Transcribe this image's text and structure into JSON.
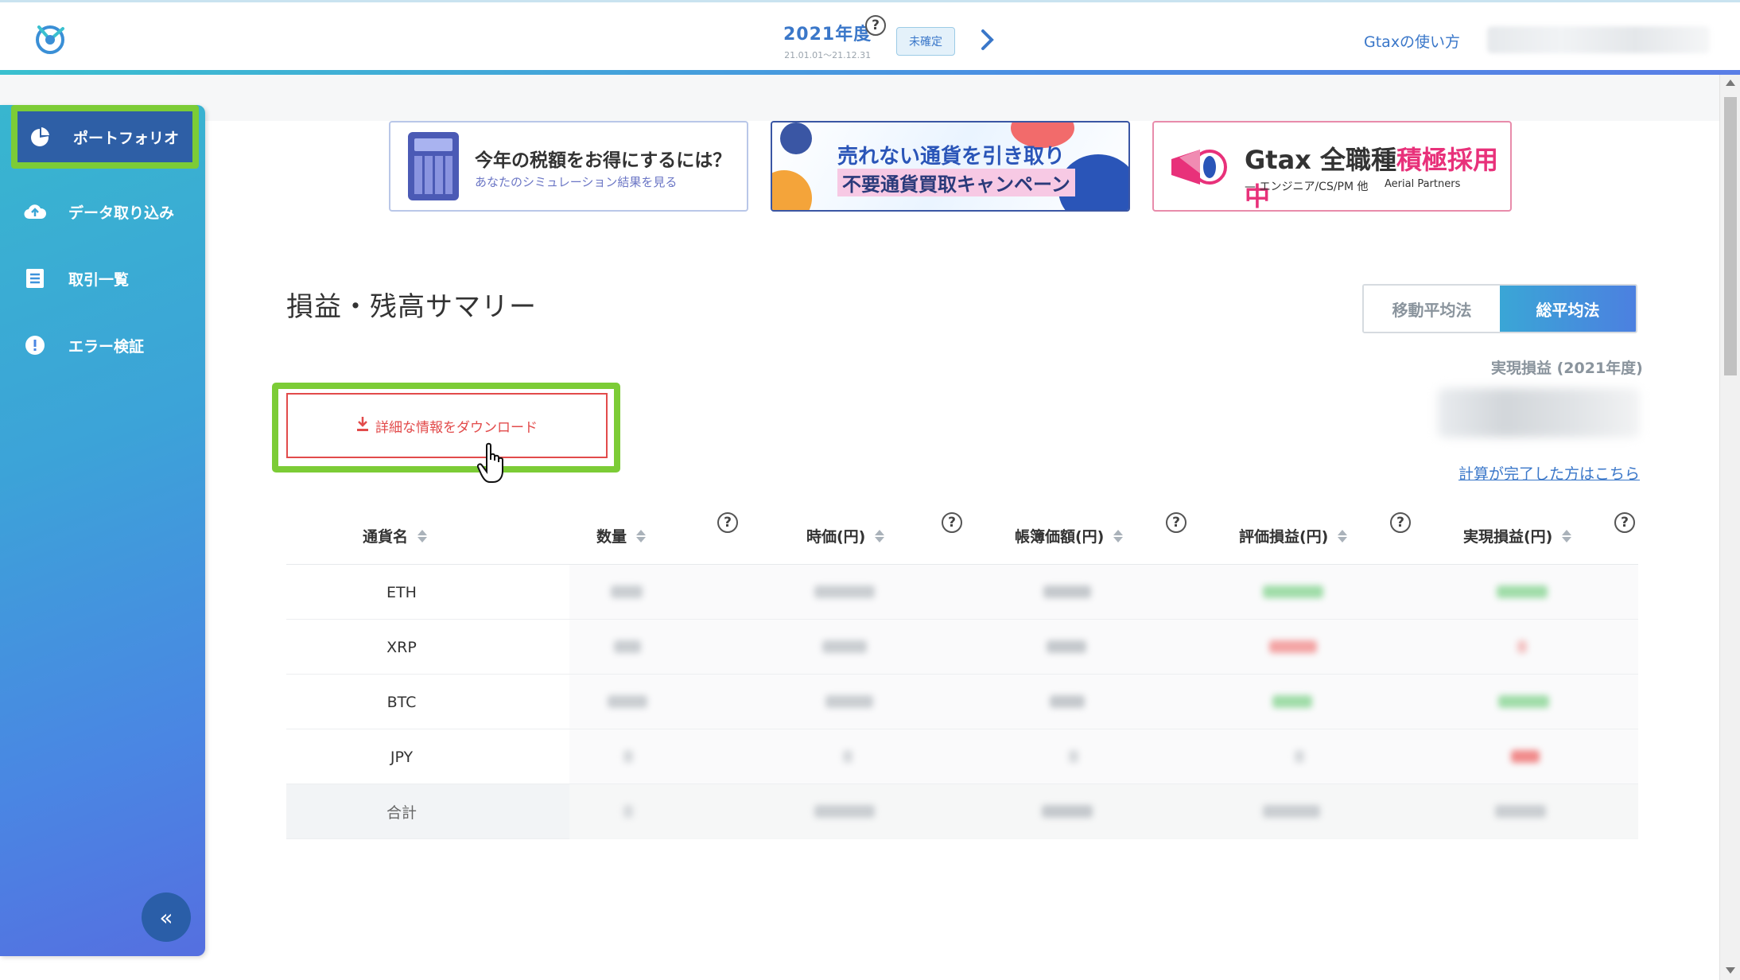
{
  "header": {
    "year_title": "2021年度",
    "year_range": "21.01.01〜21.12.31",
    "year_help": "?",
    "status_badge": "未確定",
    "next_arrow": "›",
    "help_link": "Gtaxの使い方"
  },
  "sidebar": {
    "items": [
      {
        "label": "ポートフォリオ",
        "icon": "pie-chart-icon"
      },
      {
        "label": "データ取り込み",
        "icon": "cloud-upload-icon"
      },
      {
        "label": "取引一覧",
        "icon": "list-icon"
      },
      {
        "label": "エラー検証",
        "icon": "alert-icon"
      }
    ],
    "collapse_label": "«"
  },
  "banners": {
    "b1": {
      "title": "今年の税額をお得にするには？",
      "subtitle": "あなたのシミュレーション結果を見る"
    },
    "b2": {
      "line1": "売れない通貨を引き取り",
      "line2": "不要通貨買取キャンペーン"
    },
    "b3": {
      "title_prefix": "Gtax 全職種",
      "title_accent": "積極採用中",
      "subtitle": "— エンジニア/CS/PM 他",
      "brand": "Aerial Partners"
    }
  },
  "main": {
    "page_title": "損益・残高サマリー",
    "toggles": [
      "移動平均法",
      "総平均法"
    ],
    "active_toggle": 1,
    "realized_label": "実現損益 (2021年度)",
    "calc_link": "計算が完了した方はこちら",
    "download_label": "詳細な情報をダウンロード"
  },
  "table": {
    "headers": [
      "通貨名",
      "数量",
      "時価(円)",
      "帳簿価額(円)",
      "評価損益(円)",
      "実現損益(円)"
    ],
    "help_glyph": "?",
    "rows": [
      "ETH",
      "XRP",
      "BTC",
      "JPY",
      "合計"
    ]
  },
  "colors": {
    "accent": "#3a77c9",
    "highlight": "#7ccc36",
    "download_red": "#e24b4b",
    "positive_blur": "#9fdca8",
    "negative_blur": "#f3a3a3"
  }
}
